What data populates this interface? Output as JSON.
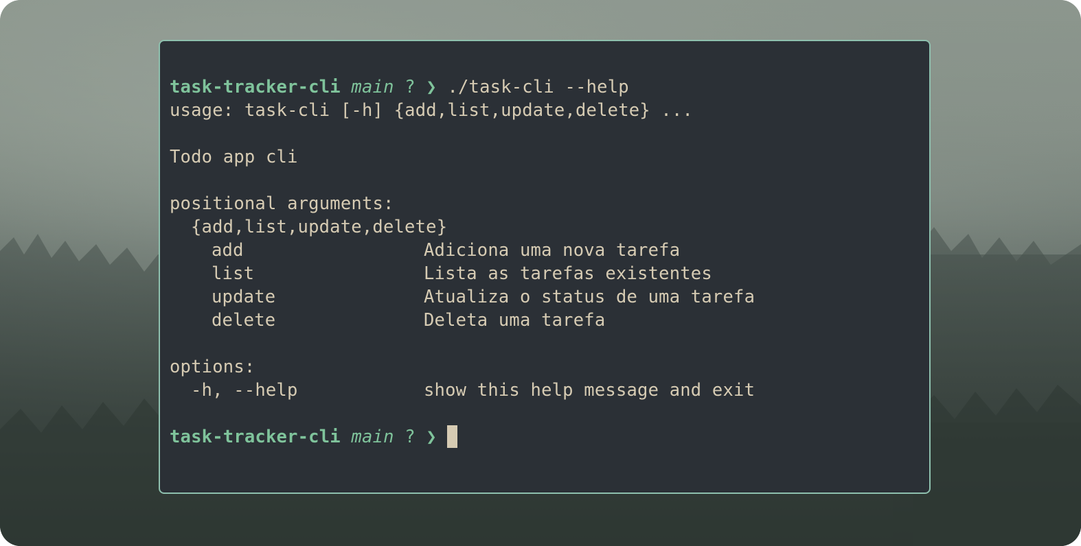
{
  "prompt": {
    "directory": "task-tracker-cli",
    "branch": "main",
    "git_status": "?",
    "arrow": "❯"
  },
  "command": "./task-cli --help",
  "output": {
    "usage": "usage: task-cli [-h] {add,list,update,delete} ...",
    "description": "Todo app cli",
    "positional_header": "positional arguments:",
    "subcommand_group": "{add,list,update,delete}",
    "subcommands": [
      {
        "name": "add",
        "help": "Adiciona uma nova tarefa"
      },
      {
        "name": "list",
        "help": "Lista as tarefas existentes"
      },
      {
        "name": "update",
        "help": "Atualiza o status de uma tarefa"
      },
      {
        "name": "delete",
        "help": "Deleta uma tarefa"
      }
    ],
    "options_header": "options:",
    "options": [
      {
        "flag": "-h, --help",
        "help": "show this help message and exit"
      }
    ]
  },
  "colors": {
    "terminal_bg": "#2b3036",
    "border": "#8ec0ae",
    "text": "#d6cbb3",
    "prompt_green": "#7fc39b"
  }
}
